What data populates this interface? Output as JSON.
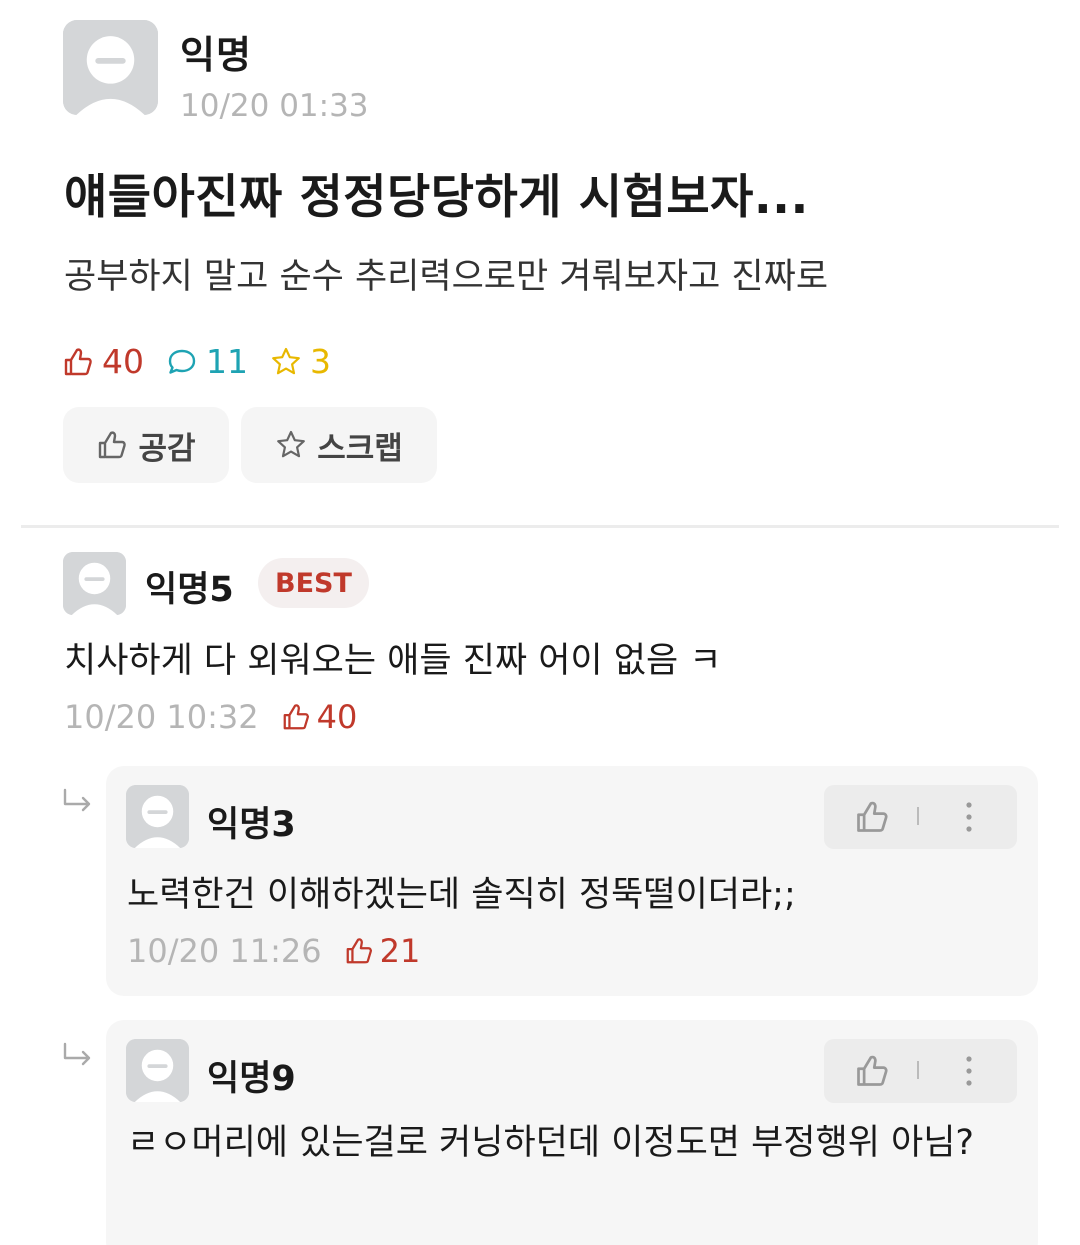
{
  "post": {
    "author": "익명",
    "time": "10/20 01:33",
    "title": "얘들아진짜 정정당당하게 시험보자...",
    "body": "공부하지 말고 순수 추리력으로만 겨뤄보자고 진짜로",
    "stats": {
      "likes": "40",
      "comments": "11",
      "scraps": "3"
    },
    "colors": {
      "like": "#c0392b",
      "comment": "#1ea3b3",
      "scrap": "#e8b800"
    }
  },
  "actions": {
    "like_label": "공감",
    "scrap_label": "스크랩"
  },
  "best_comment": {
    "author": "익명5",
    "badge": "BEST",
    "text": "치사하게 다 외워오는 애들 진짜 어이 없음 ㅋ",
    "time": "10/20 10:32",
    "likes": "40"
  },
  "replies": [
    {
      "author": "익명3",
      "text": "노력한건 이해하겠는데 솔직히 정뚝떨이더라;;",
      "time": "10/20 11:26",
      "likes": "21"
    },
    {
      "author": "익명9",
      "text": "ㄹㅇ머리에 있는걸로 커닝하던데 이정도면 부정행위 아님?"
    }
  ]
}
